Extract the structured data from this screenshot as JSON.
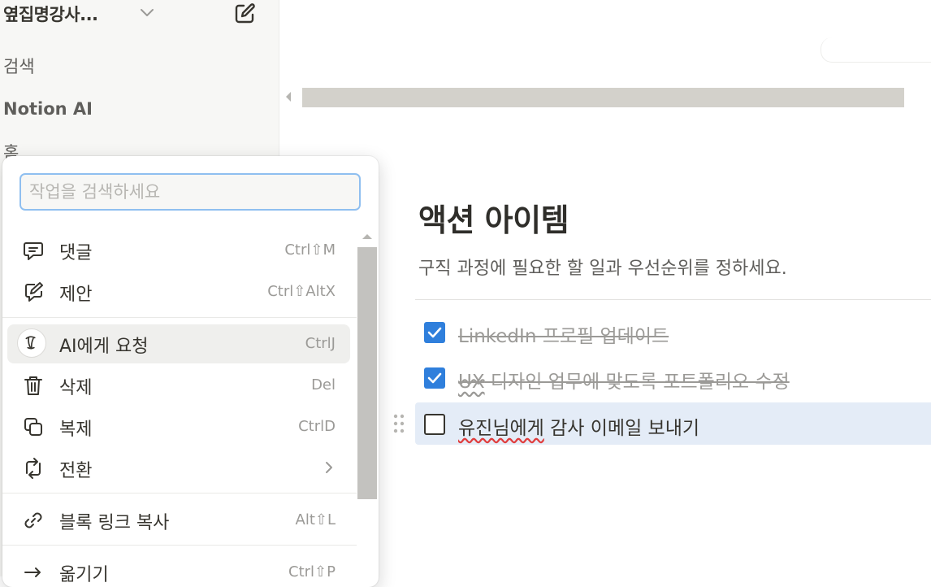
{
  "sidebar": {
    "workspace_name": "옆집명강사...",
    "items": [
      {
        "label": "검색"
      },
      {
        "label": "Notion AI"
      },
      {
        "label": "홈"
      }
    ]
  },
  "page": {
    "title": "액션 아이템",
    "description": "구직 과정에 필요한 할 일과 우선순위를 정하세요.",
    "todos": [
      {
        "text_a": "LinkedIn 프로필 업데이트",
        "text_b": "",
        "checked": true
      },
      {
        "text_a": "UX",
        "text_b": " 디자인 업무에 맞도록 포트폴리오 수정",
        "checked": true
      },
      {
        "text_a": "유진님에게",
        "text_b": " 감사 이메일 보내기",
        "checked": false
      }
    ]
  },
  "menu": {
    "search_placeholder": "작업을 검색하세요",
    "items": [
      {
        "label": "댓글",
        "shortcut": "Ctrl⇧M",
        "icon": "comment-icon"
      },
      {
        "label": "제안",
        "shortcut": "Ctrl⇧AltX",
        "icon": "suggest-edit-icon"
      },
      {
        "label": "AI에게 요청",
        "shortcut": "CtrlJ",
        "icon": "notion-ai-icon"
      },
      {
        "label": "삭제",
        "shortcut": "Del",
        "icon": "trash-icon"
      },
      {
        "label": "복제",
        "shortcut": "CtrlD",
        "icon": "duplicate-icon"
      },
      {
        "label": "전환",
        "shortcut": "",
        "icon": "turn-into-icon"
      },
      {
        "label": "블록 링크 복사",
        "shortcut": "Alt⇧L",
        "icon": "link-icon"
      },
      {
        "label": "옮기기",
        "shortcut": "Ctrl⇧P",
        "icon": "move-icon"
      }
    ]
  },
  "colors": {
    "accent": "#2f7fdc",
    "highlight_row": "#e4ecf7",
    "sidebar_bg": "#f7f7f5"
  }
}
